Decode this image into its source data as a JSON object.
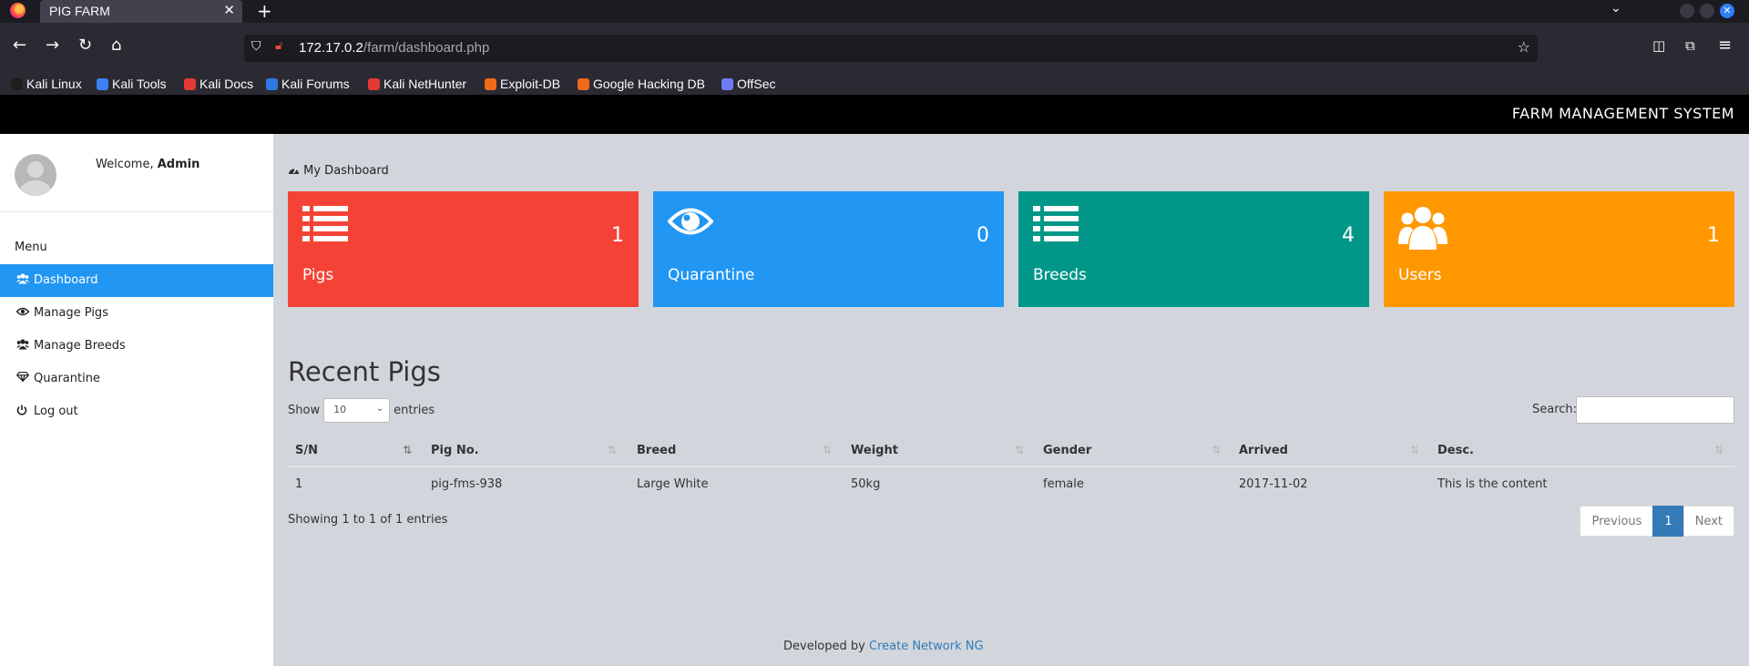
{
  "browser": {
    "tab_title": "PIG FARM",
    "url_host": "172.17.0.2",
    "url_path": "/farm/dashboard.php",
    "bookmarks": [
      {
        "label": "Kali Linux",
        "color": "#1e1e1e"
      },
      {
        "label": "Kali Tools",
        "color": "#3b82f6"
      },
      {
        "label": "Kali Docs",
        "color": "#e53935"
      },
      {
        "label": "Kali Forums",
        "color": "#2d7be0"
      },
      {
        "label": "Kali NetHunter",
        "color": "#e53935"
      },
      {
        "label": "Exploit-DB",
        "color": "#f06a1a"
      },
      {
        "label": "Google Hacking DB",
        "color": "#f06a1a"
      },
      {
        "label": "OffSec",
        "color": "#6f7bf7"
      }
    ]
  },
  "header": {
    "brand": "FARM MANAGEMENT SYSTEM"
  },
  "sidebar": {
    "welcome_prefix": "Welcome,",
    "welcome_user": "Admin",
    "menu_heading": "Menu",
    "items": [
      {
        "label": "Dashboard",
        "icon": "users-icon"
      },
      {
        "label": "Manage Pigs",
        "icon": "eye-icon"
      },
      {
        "label": "Manage Breeds",
        "icon": "users-icon"
      },
      {
        "label": "Quarantine",
        "icon": "diamond-icon"
      },
      {
        "label": "Log out",
        "icon": "power-icon"
      }
    ]
  },
  "dashboard": {
    "breadcrumb": "My Dashboard",
    "tiles": [
      {
        "label": "Pigs",
        "count": "1",
        "color": "#f44336",
        "icon": "list-icon"
      },
      {
        "label": "Quarantine",
        "count": "0",
        "color": "#2196f3",
        "icon": "eye-icon"
      },
      {
        "label": "Breeds",
        "count": "4",
        "color": "#009688",
        "icon": "list-icon"
      },
      {
        "label": "Users",
        "count": "1",
        "color": "#ff9800",
        "icon": "users-icon"
      }
    ]
  },
  "table": {
    "title": "Recent Pigs",
    "show_label": "Show",
    "entries_label": "entries",
    "page_size": "10",
    "search_label": "Search:",
    "columns": [
      "S/N",
      "Pig No.",
      "Breed",
      "Weight",
      "Gender",
      "Arrived",
      "Desc."
    ],
    "rows": [
      [
        "1",
        "pig-fms-938",
        "Large White",
        "50kg",
        "female",
        "2017-11-02",
        "This is the content"
      ]
    ],
    "info": "Showing 1 to 1 of 1 entries",
    "pagination": {
      "previous": "Previous",
      "current": "1",
      "next": "Next"
    }
  },
  "footer": {
    "prefix": "Developed by",
    "link": "Create Network NG"
  }
}
